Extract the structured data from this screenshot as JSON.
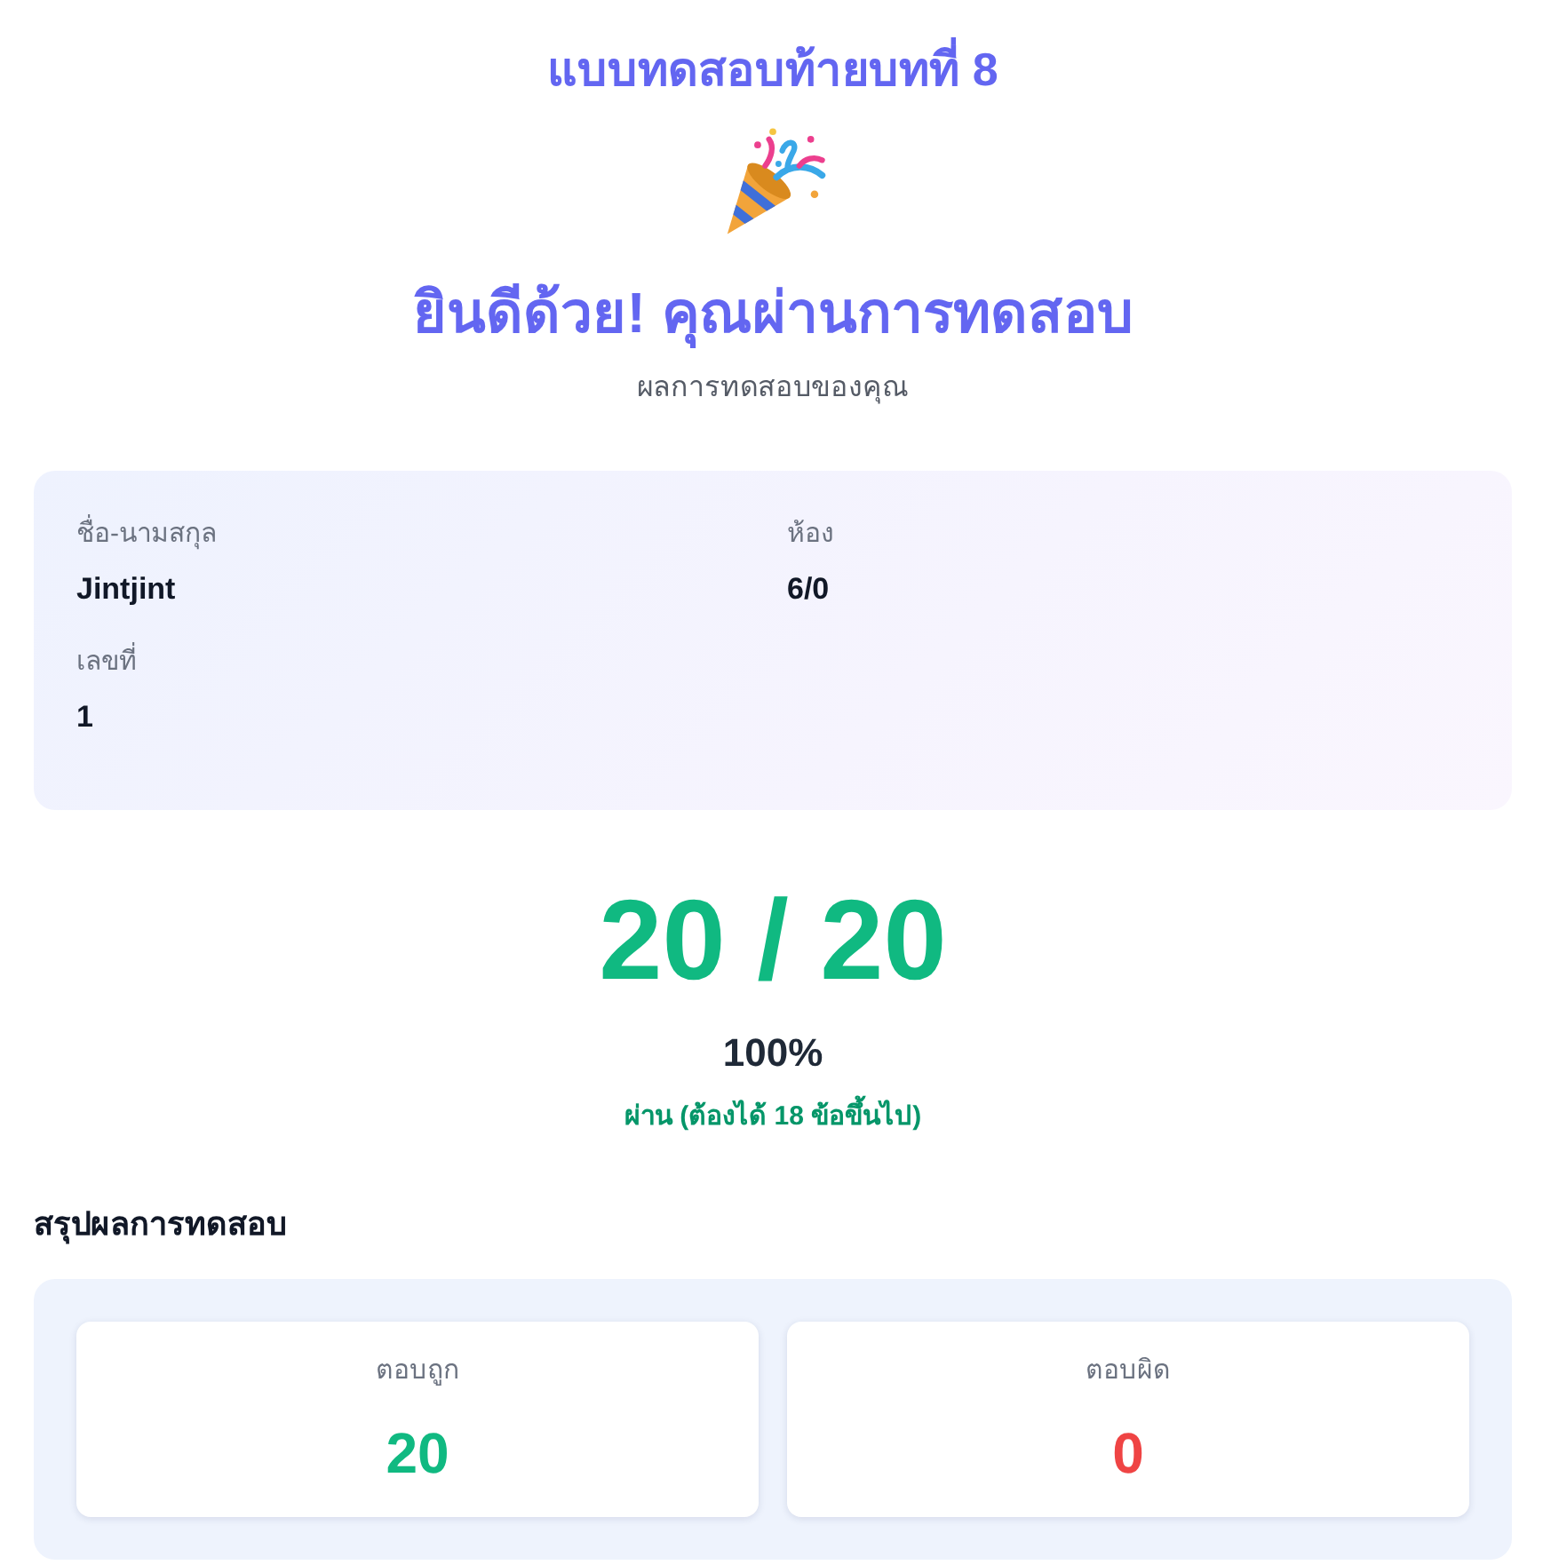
{
  "quiz_title": "แบบทดสอบท้ายบทที่ 8",
  "heading": "ยินดีด้วย! คุณผ่านการทดสอบ",
  "subtitle": "ผลการทดสอบของคุณ",
  "student_info": [
    {
      "label": "ชื่อ-นามสกุล",
      "value": "Jintjint"
    },
    {
      "label": "ห้อง",
      "value": "6/0"
    },
    {
      "label": "เลขที่",
      "value": "1"
    }
  ],
  "score": {
    "display": "20 / 20",
    "percent": "100%",
    "status": "ผ่าน (ต้องได้ 18 ข้อขึ้นไป)",
    "passed": true
  },
  "summary": {
    "title": "สรุปผลการทดสอบ",
    "cards": [
      {
        "label": "ตอบถูก",
        "value": "20",
        "kind": "correct"
      },
      {
        "label": "ตอบผิด",
        "value": "0",
        "kind": "wrong"
      }
    ]
  }
}
